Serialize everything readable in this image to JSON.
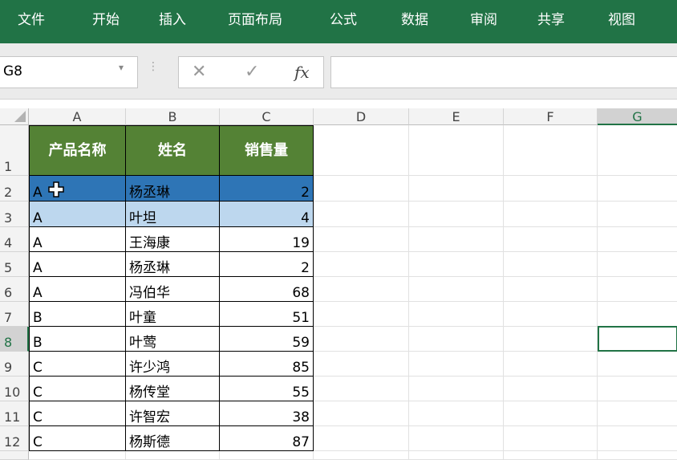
{
  "ribbon": {
    "tabs": [
      "文件",
      "开始",
      "插入",
      "页面布局",
      "公式",
      "数据",
      "审阅",
      "共享",
      "视图"
    ]
  },
  "formula_bar": {
    "name_box": "G8",
    "cancel_icon": "close-icon",
    "enter_icon": "check-icon",
    "fx_label": "fx",
    "formula": ""
  },
  "columns": [
    "A",
    "B",
    "C",
    "D",
    "E",
    "F",
    "G"
  ],
  "selected_column": "G",
  "selected_row": "8",
  "rows": [
    "1",
    "2",
    "3",
    "4",
    "5",
    "6",
    "7",
    "8",
    "9",
    "10",
    "11",
    "12"
  ],
  "table": {
    "headers": [
      "产品名称",
      "姓名",
      "销售量"
    ],
    "data": [
      [
        "A",
        "杨丞琳",
        "2"
      ],
      [
        "A",
        "叶坦",
        "4"
      ],
      [
        "A",
        "王海康",
        "19"
      ],
      [
        "A",
        "杨丞琳",
        "2"
      ],
      [
        "A",
        "冯伯华",
        "68"
      ],
      [
        "B",
        "叶童",
        "51"
      ],
      [
        "B",
        "叶莺",
        "59"
      ],
      [
        "C",
        "许少鸿",
        "85"
      ],
      [
        "C",
        "杨传堂",
        "55"
      ],
      [
        "C",
        "许智宏",
        "38"
      ],
      [
        "C",
        "杨斯德",
        "87"
      ]
    ]
  },
  "colors": {
    "ribbon": "#217346",
    "header_fill": "#548235",
    "row_selected_dark": "#2e75b6",
    "row_selected_light": "#bdd7ee"
  },
  "cursor_icon": "crosshair-plus-icon"
}
